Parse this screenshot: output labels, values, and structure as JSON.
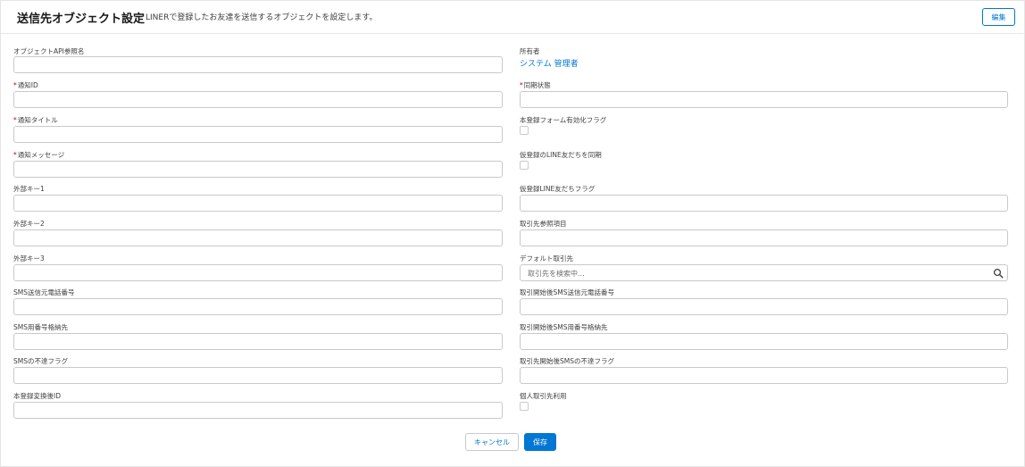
{
  "header": {
    "title": "送信先オブジェクト設定",
    "subtitle": "LINERで登録したお友達を送信するオブジェクトを設定します。",
    "edit_label": "編集"
  },
  "left_fields": [
    {
      "label": "オブジェクトAPI参照名",
      "required": false,
      "value": ""
    },
    {
      "label": "通知ID",
      "required": true,
      "value": ""
    },
    {
      "label": "通知タイトル",
      "required": true,
      "value": ""
    },
    {
      "label": "通知メッセージ",
      "required": true,
      "value": ""
    },
    {
      "label": "外部キー1",
      "required": false,
      "value": ""
    },
    {
      "label": "外部キー2",
      "required": false,
      "value": ""
    },
    {
      "label": "外部キー3",
      "required": false,
      "value": ""
    },
    {
      "label": "SMS送信元電話番号",
      "required": false,
      "value": ""
    },
    {
      "label": "SMS用番号格納先",
      "required": false,
      "value": ""
    },
    {
      "label": "SMSの不達フラグ",
      "required": false,
      "value": ""
    },
    {
      "label": "本登録変換後ID",
      "required": false,
      "value": ""
    }
  ],
  "right_fields": {
    "owner": {
      "label": "所有者",
      "value": "システム 管理者"
    },
    "sync_status": {
      "label": "同期状態",
      "required": true,
      "value": ""
    },
    "main_form_flag": {
      "label": "本登録フォーム有効化フラグ",
      "checked": false
    },
    "sync_provisional": {
      "label": "仮登録のLINE友だちを同期",
      "checked": false
    },
    "provisional_flag": {
      "label": "仮登録LINE友だちフラグ",
      "value": ""
    },
    "account_ref": {
      "label": "取引先参照項目",
      "value": ""
    },
    "default_account": {
      "label": "デフォルト取引先",
      "placeholder": "取引先を検索中..."
    },
    "post_sms_from": {
      "label": "取引開始後SMS送信元電話番号",
      "value": ""
    },
    "post_sms_store": {
      "label": "取引開始後SMS用番号格納先",
      "value": ""
    },
    "post_sms_undelivered": {
      "label": "取引先開始後SMSの不達フラグ",
      "value": ""
    },
    "personal_account": {
      "label": "個人取引先利用",
      "checked": false
    }
  },
  "footer": {
    "cancel_label": "キャンセル",
    "save_label": "保存"
  },
  "colors": {
    "brand": "#0176d3",
    "required": "#ba0517",
    "border": "#c9c9c9"
  },
  "icons": {
    "lookup": "search-icon"
  }
}
